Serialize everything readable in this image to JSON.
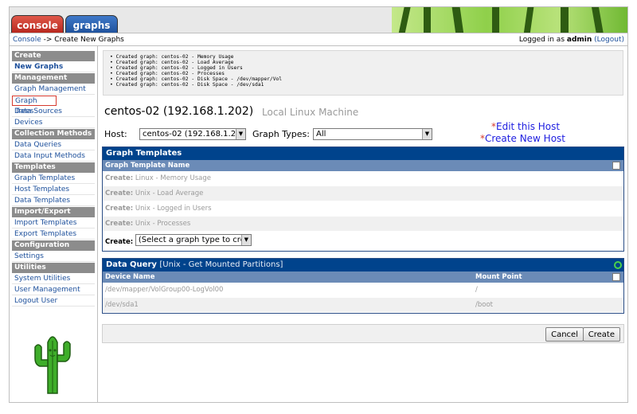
{
  "tabs": [
    {
      "label": "console"
    },
    {
      "label": "graphs"
    }
  ],
  "breadcrumb": {
    "root": "Console",
    "separator": "->",
    "current": "Create New Graphs"
  },
  "login": {
    "prefix": "Logged in as",
    "user": "admin",
    "logout_label": "(Logout)"
  },
  "sidebar": {
    "sections": [
      {
        "header": "Create",
        "items": [
          "New Graphs"
        ]
      },
      {
        "header": "Management",
        "items": [
          "Graph Management",
          "Graph Trees",
          "Data Sources",
          "Devices"
        ]
      },
      {
        "header": "Collection Methods",
        "items": [
          "Data Queries",
          "Data Input Methods"
        ]
      },
      {
        "header": "Templates",
        "items": [
          "Graph Templates",
          "Host Templates",
          "Data Templates"
        ]
      },
      {
        "header": "Import/Export",
        "items": [
          "Import Templates",
          "Export Templates"
        ]
      },
      {
        "header": "Configuration",
        "items": [
          "Settings"
        ]
      },
      {
        "header": "Utilities",
        "items": [
          "System Utilities",
          "User Management",
          "Logout User"
        ]
      }
    ],
    "selected_item": "New Graphs",
    "highlighted_item": "Graph Trees"
  },
  "messages": [
    "Created graph: centos-02 - Memory Usage",
    "Created graph: centos-02 - Load Average",
    "Created graph: centos-02 - Logged in Users",
    "Created graph: centos-02 - Processes",
    "Created graph: centos-02 - Disk Space - /dev/mapper/Vol",
    "Created graph: centos-02 - Disk Space - /dev/sda1"
  ],
  "host": {
    "title": "centos-02 (192.168.1.202)",
    "description": "Local Linux Machine"
  },
  "form": {
    "host_label": "Host:",
    "host_value": "centos-02 (192.168.1.202)",
    "graph_types_label": "Graph Types:",
    "graph_types_value": "All"
  },
  "links": {
    "edit_host": "Edit this Host",
    "create_host": "Create New Host"
  },
  "graph_templates": {
    "title": "Graph Templates",
    "column": "Graph Template Name",
    "create_prefix": "Create:",
    "rows": [
      "Linux - Memory Usage",
      "Unix - Load Average",
      "Unix - Logged in Users",
      "Unix - Processes"
    ],
    "select_placeholder": "(Select a graph type to create)"
  },
  "data_query": {
    "title": "Data Query",
    "subtitle": "[Unix - Get Mounted Partitions]",
    "columns": [
      "Device Name",
      "Mount Point"
    ],
    "rows": [
      {
        "device": "/dev/mapper/VolGroup00-LogVol00",
        "mount": "/"
      },
      {
        "device": "/dev/sda1",
        "mount": "/boot"
      }
    ]
  },
  "buttons": {
    "cancel": "Cancel",
    "create": "Create"
  },
  "colors": {
    "panel_header": "#00438c",
    "column_header": "#6b8bb7",
    "sidebar_header": "#8c8c8c",
    "link": "#1c4f9b",
    "console_tab": "#c0392b",
    "graphs_tab": "#2a5faf"
  }
}
